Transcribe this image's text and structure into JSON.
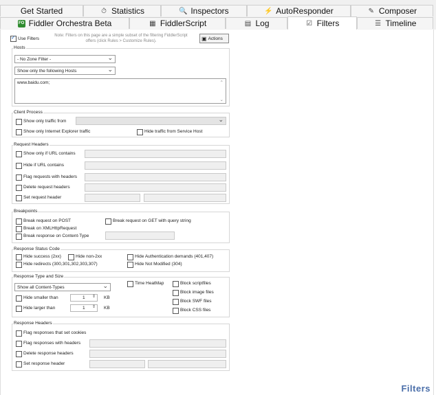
{
  "tabs_row1": [
    {
      "label": "Get Started",
      "icon": ""
    },
    {
      "label": "Statistics",
      "icon": "stopwatch-icon"
    },
    {
      "label": "Inspectors",
      "icon": "magnifier-icon"
    },
    {
      "label": "AutoResponder",
      "icon": "lightning-icon"
    },
    {
      "label": "Composer",
      "icon": "pencil-icon"
    }
  ],
  "tabs_row2": [
    {
      "label": "Fiddler Orchestra Beta",
      "icon": "fo-icon",
      "icon_text": "FO"
    },
    {
      "label": "FiddlerScript",
      "icon": "script-icon"
    },
    {
      "label": "Log",
      "icon": "log-icon"
    },
    {
      "label": "Filters",
      "icon": "checkbox-icon",
      "active": true
    },
    {
      "label": "Timeline",
      "icon": "timeline-icon"
    }
  ],
  "top": {
    "use_filters": "Use Filters",
    "note": "Note: Filters on this page are a simple subset of the filtering FiddlerScript offers (click Rules > Customize Rules).",
    "actions": "Actions"
  },
  "hosts": {
    "title": "Hosts",
    "zone": "- No Zone Filter -",
    "mode": "Show only the following Hosts",
    "list": "www.baidu.com;"
  },
  "client": {
    "title": "Client Process",
    "show_from": "Show only traffic from",
    "ie_only": "Show only Internet Explorer traffic",
    "hide_service": "Hide traffic from Service Host"
  },
  "req_headers": {
    "title": "Request Headers",
    "url_contains": "Show only if URL contains",
    "hide_url": "Hide if URL contains",
    "flag": "Flag requests with headers",
    "delete": "Delete request headers",
    "set": "Set request header"
  },
  "breakpoints": {
    "title": "Breakpoints",
    "post": "Break request on POST",
    "get": "Break request on GET with query string",
    "xhr": "Break on XMLHttpRequest",
    "ctype": "Break response on Content-Type"
  },
  "status": {
    "title": "Response Status Code",
    "success": "Hide success (2xx)",
    "non2xx": "Hide non-2xx",
    "auth": "Hide Authentication demands (401,407)",
    "redirects": "Hide redirects (300,301,302,303,307)",
    "not_modified": "Hide Not Modified (304)"
  },
  "type_size": {
    "title": "Response Type and Size",
    "content": "Show all Content-Types",
    "time_heatmap": "Time HeatMap",
    "block_script": "Block scriptfiles",
    "block_image": "Block image files",
    "block_swf": "Block SWF files",
    "block_css": "Block CSS files",
    "hide_smaller": "Hide smaller than",
    "hide_larger": "Hide larger than",
    "smaller_val": "1",
    "larger_val": "1",
    "unit": "KB"
  },
  "resp_headers": {
    "title": "Response Headers",
    "cookies": "Flag responses that set cookies",
    "flag": "Flag responses with headers",
    "delete": "Delete response headers",
    "set": "Set response header"
  },
  "footer": "Filters"
}
